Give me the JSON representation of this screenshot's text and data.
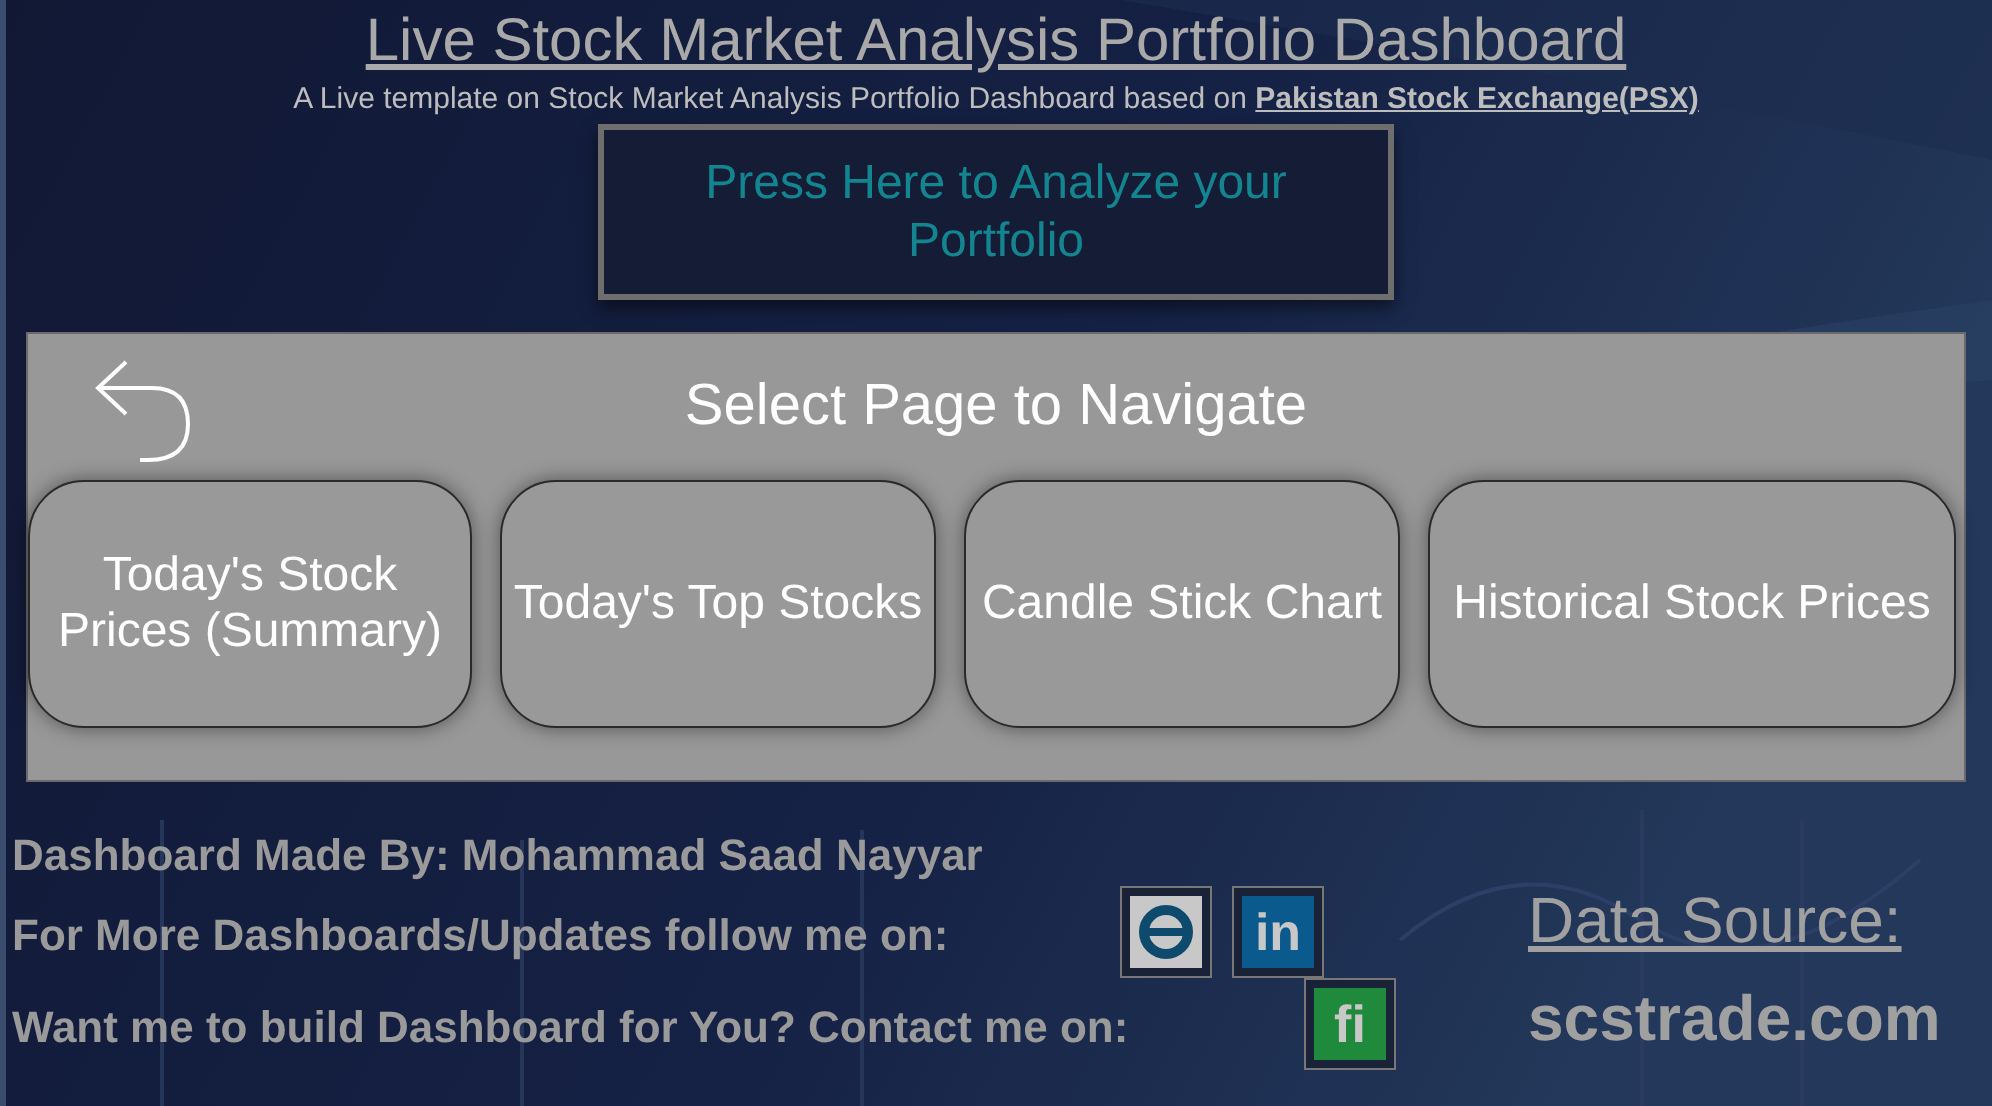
{
  "header": {
    "title": "Live Stock Market Analysis Portfolio Dashboard",
    "subtitle": "A Live template on Stock Market Analysis Portfolio Dashboard based on ",
    "subtitle_link": "Pakistan Stock Exchange(PSX)"
  },
  "analyze_button": "Press Here to Analyze your Portfolio",
  "navigation": {
    "title": "Select Page to Navigate",
    "pages": [
      "Today's Stock Prices (Summary)",
      "Today's Top Stocks",
      "Candle Stick Chart",
      "Historical Stock Prices"
    ]
  },
  "footer": {
    "made_by": "Dashboard Made By: Mohammad Saad Nayyar",
    "follow": "For More Dashboards/Updates follow me on:",
    "follow_icons": [
      {
        "kind": "ring",
        "color": "#c8c8c8"
      },
      {
        "kind": "letters",
        "text": "in",
        "color": "#0b5a8e"
      }
    ],
    "contact": "Want me to build Dashboard for You? Contact me on:",
    "contact_icons": [
      {
        "kind": "letters",
        "text": "fi",
        "color": "#1f8a3c"
      }
    ],
    "data_source_label": "Data Source:",
    "data_source": "scstrade.com"
  }
}
